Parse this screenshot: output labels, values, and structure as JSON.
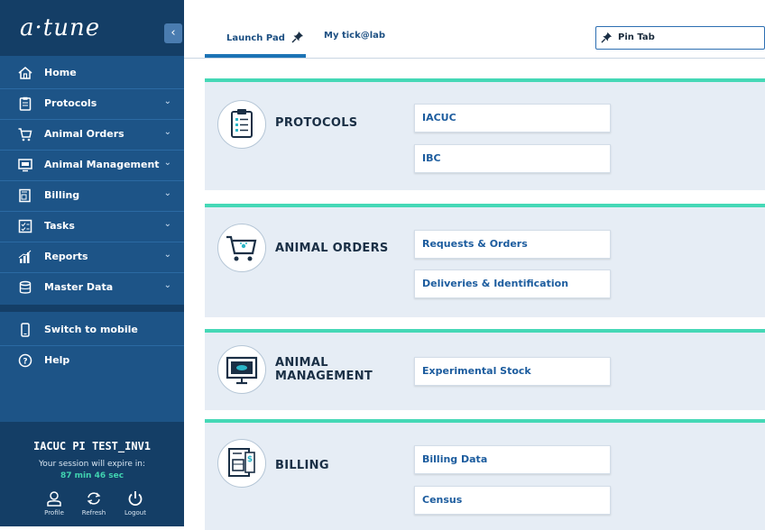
{
  "app": {
    "logo_text": "a·tune"
  },
  "sidebar": {
    "collapse_icon": "chevron-left-icon",
    "items": [
      {
        "label": "Home",
        "icon": "home-icon",
        "has_submenu": false
      },
      {
        "label": "Protocols",
        "icon": "clipboard-icon",
        "has_submenu": true
      },
      {
        "label": "Animal Orders",
        "icon": "cart-icon",
        "has_submenu": true
      },
      {
        "label": "Animal Management",
        "icon": "monitor-icon",
        "has_submenu": true
      },
      {
        "label": "Billing",
        "icon": "invoice-icon",
        "has_submenu": true
      },
      {
        "label": "Tasks",
        "icon": "tasks-icon",
        "has_submenu": true
      },
      {
        "label": "Reports",
        "icon": "chart-icon",
        "has_submenu": true
      },
      {
        "label": "Master Data",
        "icon": "database-icon",
        "has_submenu": true
      }
    ],
    "extra_items": [
      {
        "label": "Switch to mobile",
        "icon": "mobile-icon"
      },
      {
        "label": "Help",
        "icon": "help-icon"
      }
    ]
  },
  "user_panel": {
    "user_name": "IACUC PI TEST_INV1",
    "session_text": "Your session will expire in:",
    "session_time": "87 min 46 sec",
    "actions": [
      {
        "label": "Profile",
        "icon": "user-icon"
      },
      {
        "label": "Refresh",
        "icon": "refresh-icon"
      },
      {
        "label": "Logout",
        "icon": "power-icon"
      }
    ]
  },
  "topbar": {
    "tabs": [
      {
        "label": "Launch Pad",
        "active": true,
        "pinned": true
      },
      {
        "label": "My tick@lab",
        "active": false,
        "pinned": false
      }
    ],
    "pin_tab_label": "Pin Tab"
  },
  "launchpad": {
    "sections": [
      {
        "title": "PROTOCOLS",
        "icon": "clipboard-icon",
        "links": [
          "IACUC",
          "IBC"
        ]
      },
      {
        "title": "ANIMAL ORDERS",
        "icon": "cart-icon",
        "links": [
          "Requests & Orders",
          "Deliveries & Identification"
        ]
      },
      {
        "title_line1": "ANIMAL",
        "title_line2": "MANAGEMENT",
        "icon": "monitor-icon",
        "links": [
          "Experimental Stock"
        ]
      },
      {
        "title": "BILLING",
        "icon": "invoice-icon",
        "links": [
          "Billing Data",
          "Census"
        ]
      }
    ]
  },
  "colors": {
    "sidebar_dark": "#143e66",
    "sidebar_item": "#1d5487",
    "accent_teal": "#45d8b6",
    "link_blue": "#1c5c9e",
    "card_bg": "#e6edf5"
  }
}
